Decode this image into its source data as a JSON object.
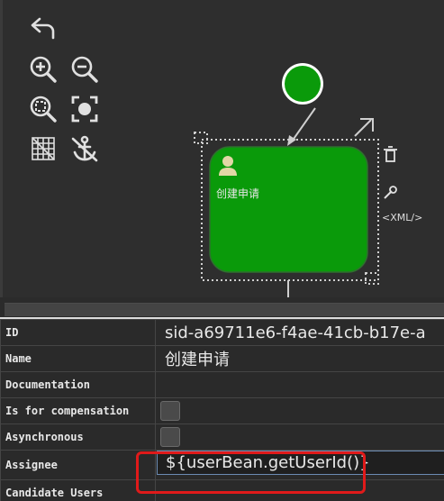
{
  "toolbar": {
    "tools": [
      {
        "icon": "undo-icon"
      },
      {
        "icon": "zoom-in-icon"
      },
      {
        "icon": "zoom-out-icon"
      },
      {
        "icon": "zoom-fit-icon"
      },
      {
        "icon": "zoom-actual-icon"
      },
      {
        "icon": "grid-icon"
      },
      {
        "icon": "anchor-icon"
      }
    ]
  },
  "diagram": {
    "task_label": "创建申请",
    "xml_label": "<XML/>",
    "colors": {
      "task_fill": "#0a9a0a",
      "start_fill": "#0a9a0a",
      "selection": "#cfcfcf"
    }
  },
  "properties": {
    "rows": [
      {
        "key": "ID",
        "value": "sid-a69711e6-f4ae-41cb-b17e-a"
      },
      {
        "key": "Name",
        "value": "创建申请"
      },
      {
        "key": "Documentation",
        "value": ""
      },
      {
        "key": "Is for compensation",
        "value": ""
      },
      {
        "key": "Asynchronous",
        "value": ""
      },
      {
        "key": "Assignee",
        "value": "${userBean.getUserId()}"
      },
      {
        "key": "Candidate Users",
        "value": ""
      }
    ]
  },
  "highlight_color": "#e01a1a"
}
